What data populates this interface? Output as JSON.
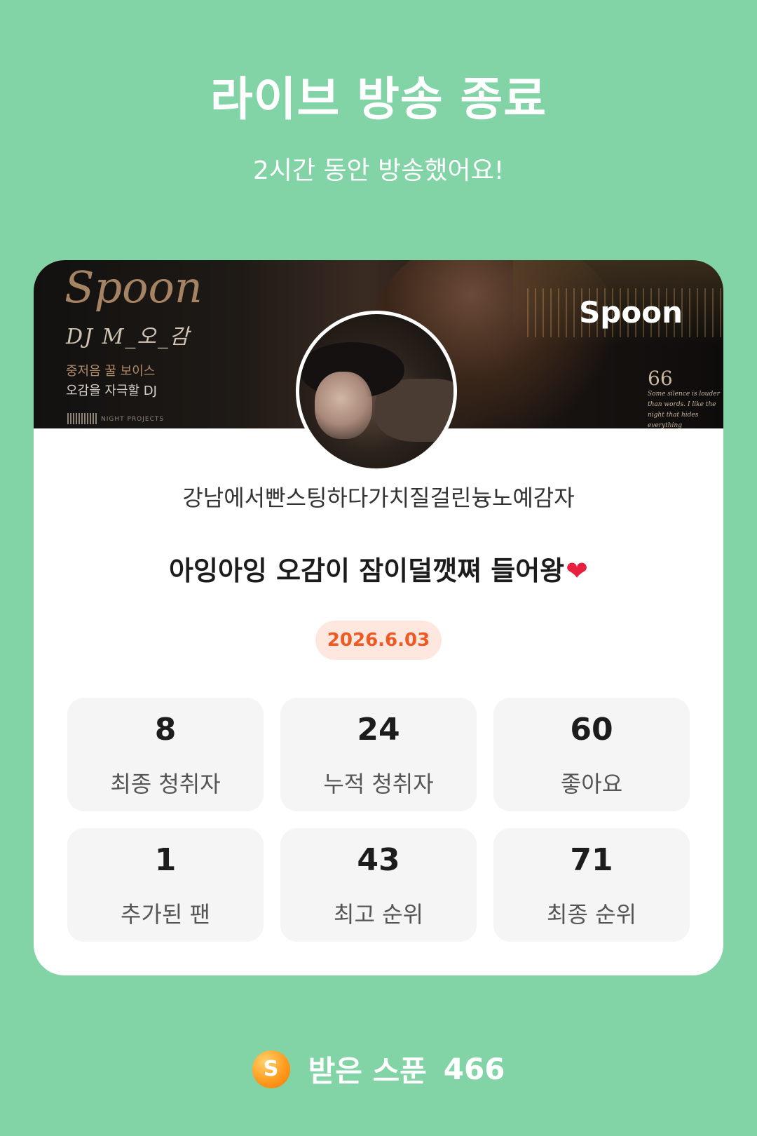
{
  "header": {
    "title": "라이브 방송 종료",
    "subtitle": "2시간 동안 방송했어요!"
  },
  "banner": {
    "brand_script": "Spoon",
    "dj_name": "DJ M_오_감",
    "tagline_1": "중저음 꿀 보이스",
    "tagline_2": "오감을 자극할 DJ",
    "small_tag": "NIGHT PROJECTS",
    "logo": "Spoon",
    "quote_mark": "66",
    "quote_text": "Some silence is louder than words. I like the night that hides everything"
  },
  "profile": {
    "nickname": "강남에서빤스팅하다가치질걸린늉노예감자",
    "stream_title": "아잉아잉 오감이 잠이덜깻쪄 들어왕",
    "heart_emoji": "❤",
    "date": "2026.6.03"
  },
  "stats": [
    {
      "value": "8",
      "label": "최종 청취자"
    },
    {
      "value": "24",
      "label": "누적 청취자"
    },
    {
      "value": "60",
      "label": "좋아요"
    },
    {
      "value": "1",
      "label": "추가된 팬"
    },
    {
      "value": "43",
      "label": "최고 순위"
    },
    {
      "value": "71",
      "label": "최종 순위"
    }
  ],
  "footer": {
    "coin_letter": "S",
    "label": "받은 스푼",
    "value": "466"
  },
  "colors": {
    "background": "#82d4a7",
    "card": "#ffffff",
    "badge_bg": "#fde7df",
    "badge_text": "#ef5a24",
    "coin": "#ff9b1d"
  }
}
